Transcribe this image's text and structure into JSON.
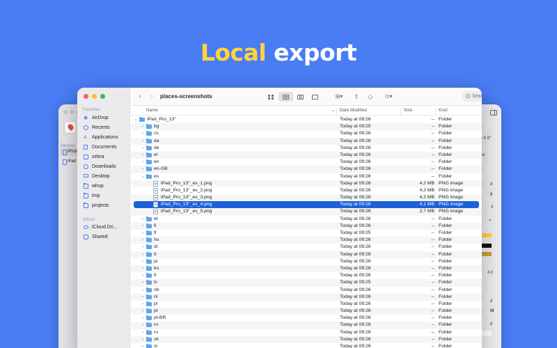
{
  "headline": {
    "part1": "Local",
    "part2": "export"
  },
  "colors": {
    "background": "#4a7cf3",
    "headline_accent": "#ffd43b",
    "selection": "#1d61d9",
    "folder": "#5ba5f0"
  },
  "back_left": {
    "section": "Devices",
    "devices": [
      {
        "label": "iPhone",
        "selected": true
      },
      {
        "label": "iPad P",
        "selected": false
      }
    ]
  },
  "back_right": {
    "fragments": [
      "s 6.9\"",
      "pe",
      "d",
      "y",
      "4.0",
      "d",
      "ld",
      "d"
    ]
  },
  "finder": {
    "path_title": "places-screenshots",
    "search_placeholder": "Search",
    "sidebar": {
      "favorites_heading": "Favorites",
      "favorites": [
        {
          "label": "AirDrop",
          "icon": "airdrop-icon"
        },
        {
          "label": "Recents",
          "icon": "clock-icon"
        },
        {
          "label": "Applications",
          "icon": "applications-icon"
        },
        {
          "label": "Documents",
          "icon": "document-icon"
        },
        {
          "label": "zebra",
          "icon": "house-icon"
        },
        {
          "label": "Downloads",
          "icon": "download-icon"
        },
        {
          "label": "Desktop",
          "icon": "monitor-icon"
        },
        {
          "label": "whop",
          "icon": "folder-icon"
        },
        {
          "label": "tmp",
          "icon": "folder-icon"
        },
        {
          "label": "projects",
          "icon": "folder-icon"
        }
      ],
      "icloud_heading": "iCloud",
      "icloud": [
        {
          "label": "iCloud Dri...",
          "icon": "cloud-icon"
        },
        {
          "label": "Shared",
          "icon": "shared-folder-icon"
        }
      ]
    },
    "columns": {
      "name": "Name",
      "date": "Date Modified",
      "size": "Size",
      "kind": "Kind"
    },
    "rows": [
      {
        "name": "iPad_Pro_13\"",
        "date": "Today at 09:26",
        "size": "--",
        "kind": "Folder",
        "type": "folder",
        "level": 0,
        "expanded": true
      },
      {
        "name": "bg",
        "date": "Today at 09:25",
        "size": "--",
        "kind": "Folder",
        "type": "folder",
        "level": 1
      },
      {
        "name": "cs",
        "date": "Today at 09:26",
        "size": "--",
        "kind": "Folder",
        "type": "folder",
        "level": 1
      },
      {
        "name": "da",
        "date": "Today at 09:26",
        "size": "--",
        "kind": "Folder",
        "type": "folder",
        "level": 1
      },
      {
        "name": "de",
        "date": "Today at 09:26",
        "size": "--",
        "kind": "Folder",
        "type": "folder",
        "level": 1
      },
      {
        "name": "el",
        "date": "Today at 09:26",
        "size": "--",
        "kind": "Folder",
        "type": "folder",
        "level": 1
      },
      {
        "name": "en",
        "date": "Today at 09:26",
        "size": "--",
        "kind": "Folder",
        "type": "folder",
        "level": 1
      },
      {
        "name": "en-GB",
        "date": "Today at 09:26",
        "size": "--",
        "kind": "Folder",
        "type": "folder",
        "level": 1
      },
      {
        "name": "es",
        "date": "Today at 09:26",
        "size": "--",
        "kind": "Folder",
        "type": "folder",
        "level": 1,
        "expanded": true
      },
      {
        "name": "iPad_Pro_13\"_es_1.png",
        "date": "Today at 09:26",
        "size": "4,2 MB",
        "kind": "PNG image",
        "type": "file",
        "level": 2
      },
      {
        "name": "iPad_Pro_13\"_es_2.png",
        "date": "Today at 09:26",
        "size": "4,3 MB",
        "kind": "PNG image",
        "type": "file",
        "level": 2
      },
      {
        "name": "iPad_Pro_13\"_es_3.png",
        "date": "Today at 09:26",
        "size": "4,2 MB",
        "kind": "PNG image",
        "type": "file",
        "level": 2
      },
      {
        "name": "iPad_Pro_13\"_es_4.png",
        "date": "Today at 09:26",
        "size": "4,1 MB",
        "kind": "PNG image",
        "type": "file",
        "level": 2,
        "selected": true
      },
      {
        "name": "iPad_Pro_13\"_es_5.png",
        "date": "Today at 09:26",
        "size": "2,7 MB",
        "kind": "PNG image",
        "type": "file",
        "level": 2
      },
      {
        "name": "et",
        "date": "Today at 09:26",
        "size": "--",
        "kind": "Folder",
        "type": "folder",
        "level": 1
      },
      {
        "name": "fi",
        "date": "Today at 09:26",
        "size": "--",
        "kind": "Folder",
        "type": "folder",
        "level": 1
      },
      {
        "name": "fr",
        "date": "Today at 09:25",
        "size": "--",
        "kind": "Folder",
        "type": "folder",
        "level": 1
      },
      {
        "name": "hu",
        "date": "Today at 09:26",
        "size": "--",
        "kind": "Folder",
        "type": "folder",
        "level": 1
      },
      {
        "name": "id",
        "date": "Today at 09:26",
        "size": "--",
        "kind": "Folder",
        "type": "folder",
        "level": 1
      },
      {
        "name": "it",
        "date": "Today at 09:26",
        "size": "--",
        "kind": "Folder",
        "type": "folder",
        "level": 1
      },
      {
        "name": "ja",
        "date": "Today at 09:26",
        "size": "--",
        "kind": "Folder",
        "type": "folder",
        "level": 1
      },
      {
        "name": "ko",
        "date": "Today at 09:26",
        "size": "--",
        "kind": "Folder",
        "type": "folder",
        "level": 1
      },
      {
        "name": "lt",
        "date": "Today at 09:26",
        "size": "--",
        "kind": "Folder",
        "type": "folder",
        "level": 1
      },
      {
        "name": "lv",
        "date": "Today at 09:25",
        "size": "--",
        "kind": "Folder",
        "type": "folder",
        "level": 1
      },
      {
        "name": "nb",
        "date": "Today at 09:26",
        "size": "--",
        "kind": "Folder",
        "type": "folder",
        "level": 1
      },
      {
        "name": "nl",
        "date": "Today at 09:26",
        "size": "--",
        "kind": "Folder",
        "type": "folder",
        "level": 1
      },
      {
        "name": "pl",
        "date": "Today at 09:26",
        "size": "--",
        "kind": "Folder",
        "type": "folder",
        "level": 1
      },
      {
        "name": "pt",
        "date": "Today at 09:26",
        "size": "--",
        "kind": "Folder",
        "type": "folder",
        "level": 1
      },
      {
        "name": "pt-BR",
        "date": "Today at 09:26",
        "size": "--",
        "kind": "Folder",
        "type": "folder",
        "level": 1
      },
      {
        "name": "ro",
        "date": "Today at 09:26",
        "size": "--",
        "kind": "Folder",
        "type": "folder",
        "level": 1
      },
      {
        "name": "ru",
        "date": "Today at 09:26",
        "size": "--",
        "kind": "Folder",
        "type": "folder",
        "level": 1
      },
      {
        "name": "sk",
        "date": "Today at 09:26",
        "size": "--",
        "kind": "Folder",
        "type": "folder",
        "level": 1
      },
      {
        "name": "sl",
        "date": "Today at 09:26",
        "size": "--",
        "kind": "Folder",
        "type": "folder",
        "level": 1
      }
    ]
  }
}
